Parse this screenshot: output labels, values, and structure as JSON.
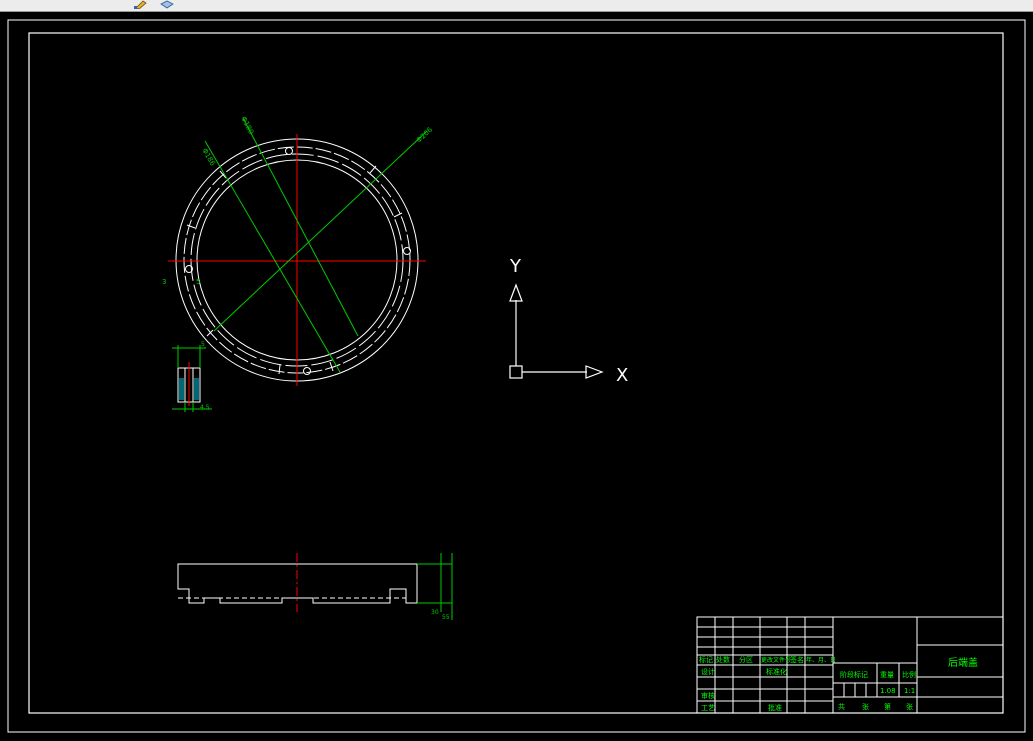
{
  "app": {
    "toolbar": {
      "icons": [
        "pencil-tool-icon",
        "layer-properties-icon"
      ]
    },
    "drawing": {
      "background": "#000000",
      "colors": {
        "outline": "#ffffff",
        "centerline": "#ff0000",
        "dimension": "#00cc00",
        "hatch": "#00bcd4",
        "title_text": "#00ff00"
      },
      "dimension_labels": {
        "dia_left": "Φ186",
        "dia_mid": "Φ180",
        "dia_right": "Φ206",
        "detail_top": "5",
        "detail_bottom": "4.5",
        "section_mark_a": "3",
        "section_mark_b": "5",
        "side_h1": "30",
        "side_h2": "55"
      },
      "ucs": {
        "x_label": "X",
        "y_label": "Y"
      }
    },
    "title_block": {
      "row_labels": [
        "标记",
        "处数",
        "分区",
        "更改文件号",
        "签名",
        "年、月、日"
      ],
      "design_label": "设计",
      "standardize_label": "标准化",
      "review_label": "审核",
      "process_label": "工艺",
      "approve_label": "批准",
      "stage_label": "阶段标记",
      "weight_label": "重量",
      "scale_label": "比例",
      "weight_value": "1.08",
      "scale_value": "1:1",
      "sheet_labels": [
        "共",
        "张",
        "第",
        "张"
      ],
      "part_name": "后端盖"
    }
  }
}
